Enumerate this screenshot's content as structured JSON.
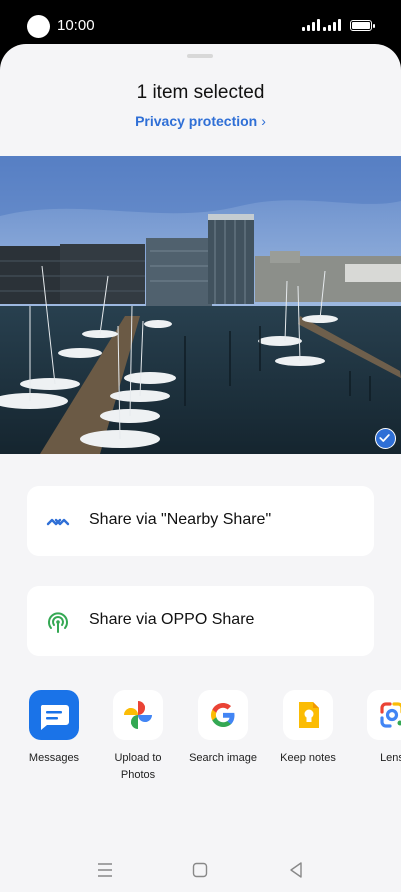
{
  "status": {
    "time": "10:00"
  },
  "sheet": {
    "title": "1 item selected",
    "privacy_link": "Privacy protection"
  },
  "share_options": [
    {
      "label": "Share via \"Nearby Share\""
    },
    {
      "label": "Share via OPPO Share"
    }
  ],
  "apps": [
    {
      "name": "Messages"
    },
    {
      "name": "Upload to Photos"
    },
    {
      "name": "Search image"
    },
    {
      "name": "Keep notes"
    },
    {
      "name": "Lens"
    }
  ],
  "colors": {
    "accent": "#2f6fd6",
    "sheet_bg": "#f5f5f7"
  }
}
